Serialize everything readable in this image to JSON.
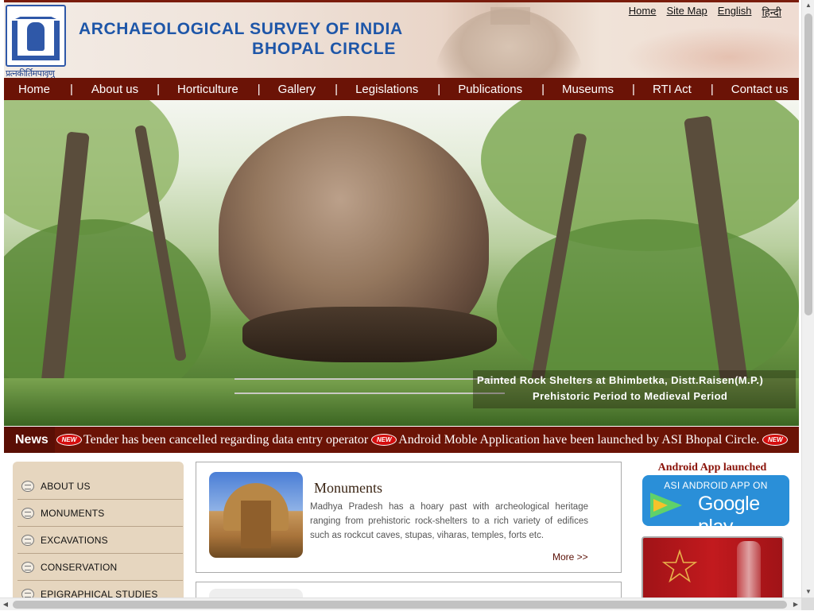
{
  "header": {
    "title_line1": "ARCHAEOLOGICAL SURVEY OF INDIA",
    "title_line2": "BHOPAL CIRCLE",
    "emblem_motto": "प्रत्नकीर्तिमपावृणु",
    "top_links": [
      "Home",
      "Site Map",
      "English",
      "हिन्दी"
    ]
  },
  "nav": {
    "items": [
      "Home",
      "About us",
      "Horticulture",
      "Gallery",
      "Legislations",
      "Publications",
      "Museums",
      "RTI Act",
      "Contact us"
    ],
    "separator": "|"
  },
  "banner": {
    "caption_line1": "Painted Rock Shelters at Bhimbetka, Distt.Raisen(M.P.)",
    "caption_line2": "Prehistoric  Period to Medieval Period"
  },
  "news": {
    "label": "News",
    "badge": "NEW",
    "items": [
      "Tender has been cancelled regarding data entry operator",
      "Android Moble Application have been launched by ASI Bhopal Circle."
    ]
  },
  "sidebar": {
    "items": [
      "ABOUT US",
      "MONUMENTS",
      "EXCAVATIONS",
      "CONSERVATION",
      "EPIGRAPHICAL STUDIES"
    ]
  },
  "content": {
    "monuments": {
      "title": "Monuments",
      "text": "Madhya Pradesh has a hoary past with archeological heritage ranging from prehistoric rock-shelters to a rich variety of edifices such as rockcut caves, stupas, viharas, temples, forts etc.",
      "more": "More >>"
    }
  },
  "right": {
    "android_title": "Android App launched",
    "gplay_line1": "ASI ANDROID APP ON",
    "gplay_line2": "Google play"
  },
  "colors": {
    "nav_bg": "#6b1306",
    "title_blue": "#1e56a8",
    "accent_red": "#8a1208"
  }
}
